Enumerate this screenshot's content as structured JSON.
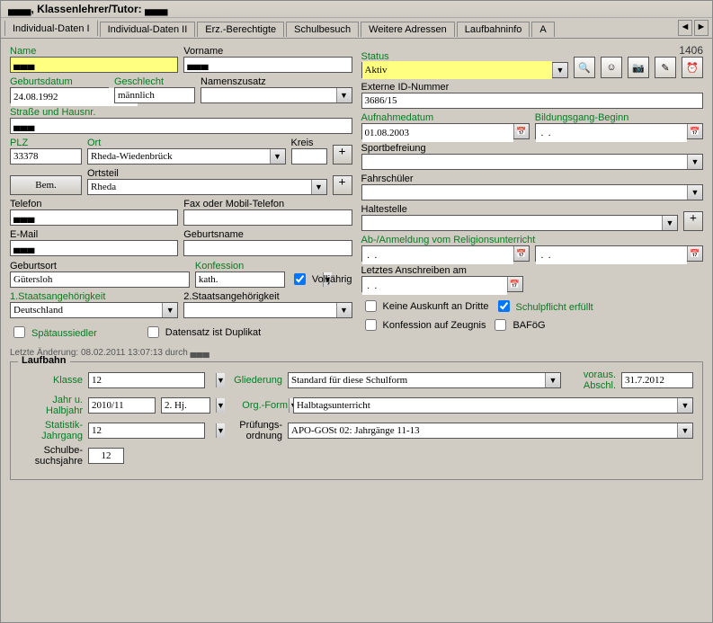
{
  "header": {
    "title": "▄▄▄, Klassenlehrer/Tutor: ▄▄▄"
  },
  "tabs": [
    "Individual-Daten I",
    "Individual-Daten II",
    "Erz.-Berechtigte",
    "Schulbesuch",
    "Weitere Adressen",
    "Laufbahninfo",
    "A"
  ],
  "id_number": "1406",
  "left": {
    "name_label": "Name",
    "name_value": "▄▄▄",
    "vorname_label": "Vorname",
    "vorname_value": "▄▄▄",
    "geburtsdatum_label": "Geburtsdatum",
    "geburtsdatum_value": "24.08.1992",
    "geschlecht_label": "Geschlecht",
    "geschlecht_value": "männlich",
    "namenszusatz_label": "Namenszusatz",
    "namenszusatz_value": "",
    "strasse_label": "Straße und Hausnr.",
    "strasse_value": "▄▄▄",
    "plz_label": "PLZ",
    "plz_value": "33378",
    "ort_label": "Ort",
    "ort_value": "Rheda-Wiedenbrück",
    "kreis_label": "Kreis",
    "kreis_value": "",
    "ortsteil_label": "Ortsteil",
    "ortsteil_value": "Rheda",
    "bem_label": "Bem.",
    "telefon_label": "Telefon",
    "telefon_value": "▄▄▄",
    "fax_label": "Fax oder Mobil-Telefon",
    "fax_value": "",
    "email_label": "E-Mail",
    "email_value": "▄▄▄",
    "geburtsname_label": "Geburtsname",
    "geburtsname_value": "",
    "geburtsort_label": "Geburtsort",
    "geburtsort_value": "Gütersloh",
    "konfession_label": "Konfession",
    "konfession_value": "kath.",
    "volljaehrig_label": "Volljährig",
    "staat1_label": "1.Staatsangehörigkeit",
    "staat1_value": "Deutschland",
    "staat2_label": "2.Staatsangehörigkeit",
    "staat2_value": "",
    "spaetaussiedler_label": "Spätaussiedler",
    "duplikat_label": "Datensatz ist Duplikat"
  },
  "right": {
    "status_label": "Status",
    "status_value": "Aktiv",
    "extid_label": "Externe ID-Nummer",
    "extid_value": "3686/15",
    "aufnahme_label": "Aufnahmedatum",
    "aufnahme_value": "01.08.2003",
    "bildungsgang_label": "Bildungsgang-Beginn",
    "bildungsgang_value": " .  .",
    "sport_label": "Sportbefreiung",
    "sport_value": "",
    "fahr_label": "Fahrschüler",
    "fahr_value": "",
    "halte_label": "Haltestelle",
    "halte_value": "",
    "religion_label": "Ab-/Anmeldung vom Religionsunterricht",
    "religion_ab": " .  .",
    "religion_an": " .  .",
    "anschreiben_label": "Letztes Anschreiben am",
    "anschreiben_value": " .  .",
    "keineauskunft_label": "Keine Auskunft an Dritte",
    "schulpflicht_label": "Schulpflicht erfüllt",
    "konfzeugnis_label": "Konfession auf Zeugnis",
    "bafoeg_label": "BAFöG"
  },
  "footer_note": "Letzte Änderung: 08.02.2011 13:07:13 durch ▄▄▄",
  "laufbahn": {
    "legend": "Laufbahn",
    "klasse_label": "Klasse",
    "klasse_value": "12",
    "gliederung_label": "Gliederung",
    "gliederung_value": "Standard für diese Schulform",
    "abschluss_label": "voraus. Abschl.",
    "abschluss_value": "31.7.2012",
    "jahr_label": "Jahr u. Halbjahr",
    "jahr_value": "2010/11",
    "hj_value": "2. Hj.",
    "orgform_label": "Org.-Form",
    "orgform_value": "Halbtagsunterricht",
    "statjg_label": "Statistik-Jahrgang",
    "statjg_value": "12",
    "pruef_label": "Prüfungs-ordnung",
    "pruef_value": "APO-GOSt 02: Jahrgänge 11-13",
    "schuljahre_label": "Schulbe-suchsjahre",
    "schuljahre_value": "12"
  }
}
